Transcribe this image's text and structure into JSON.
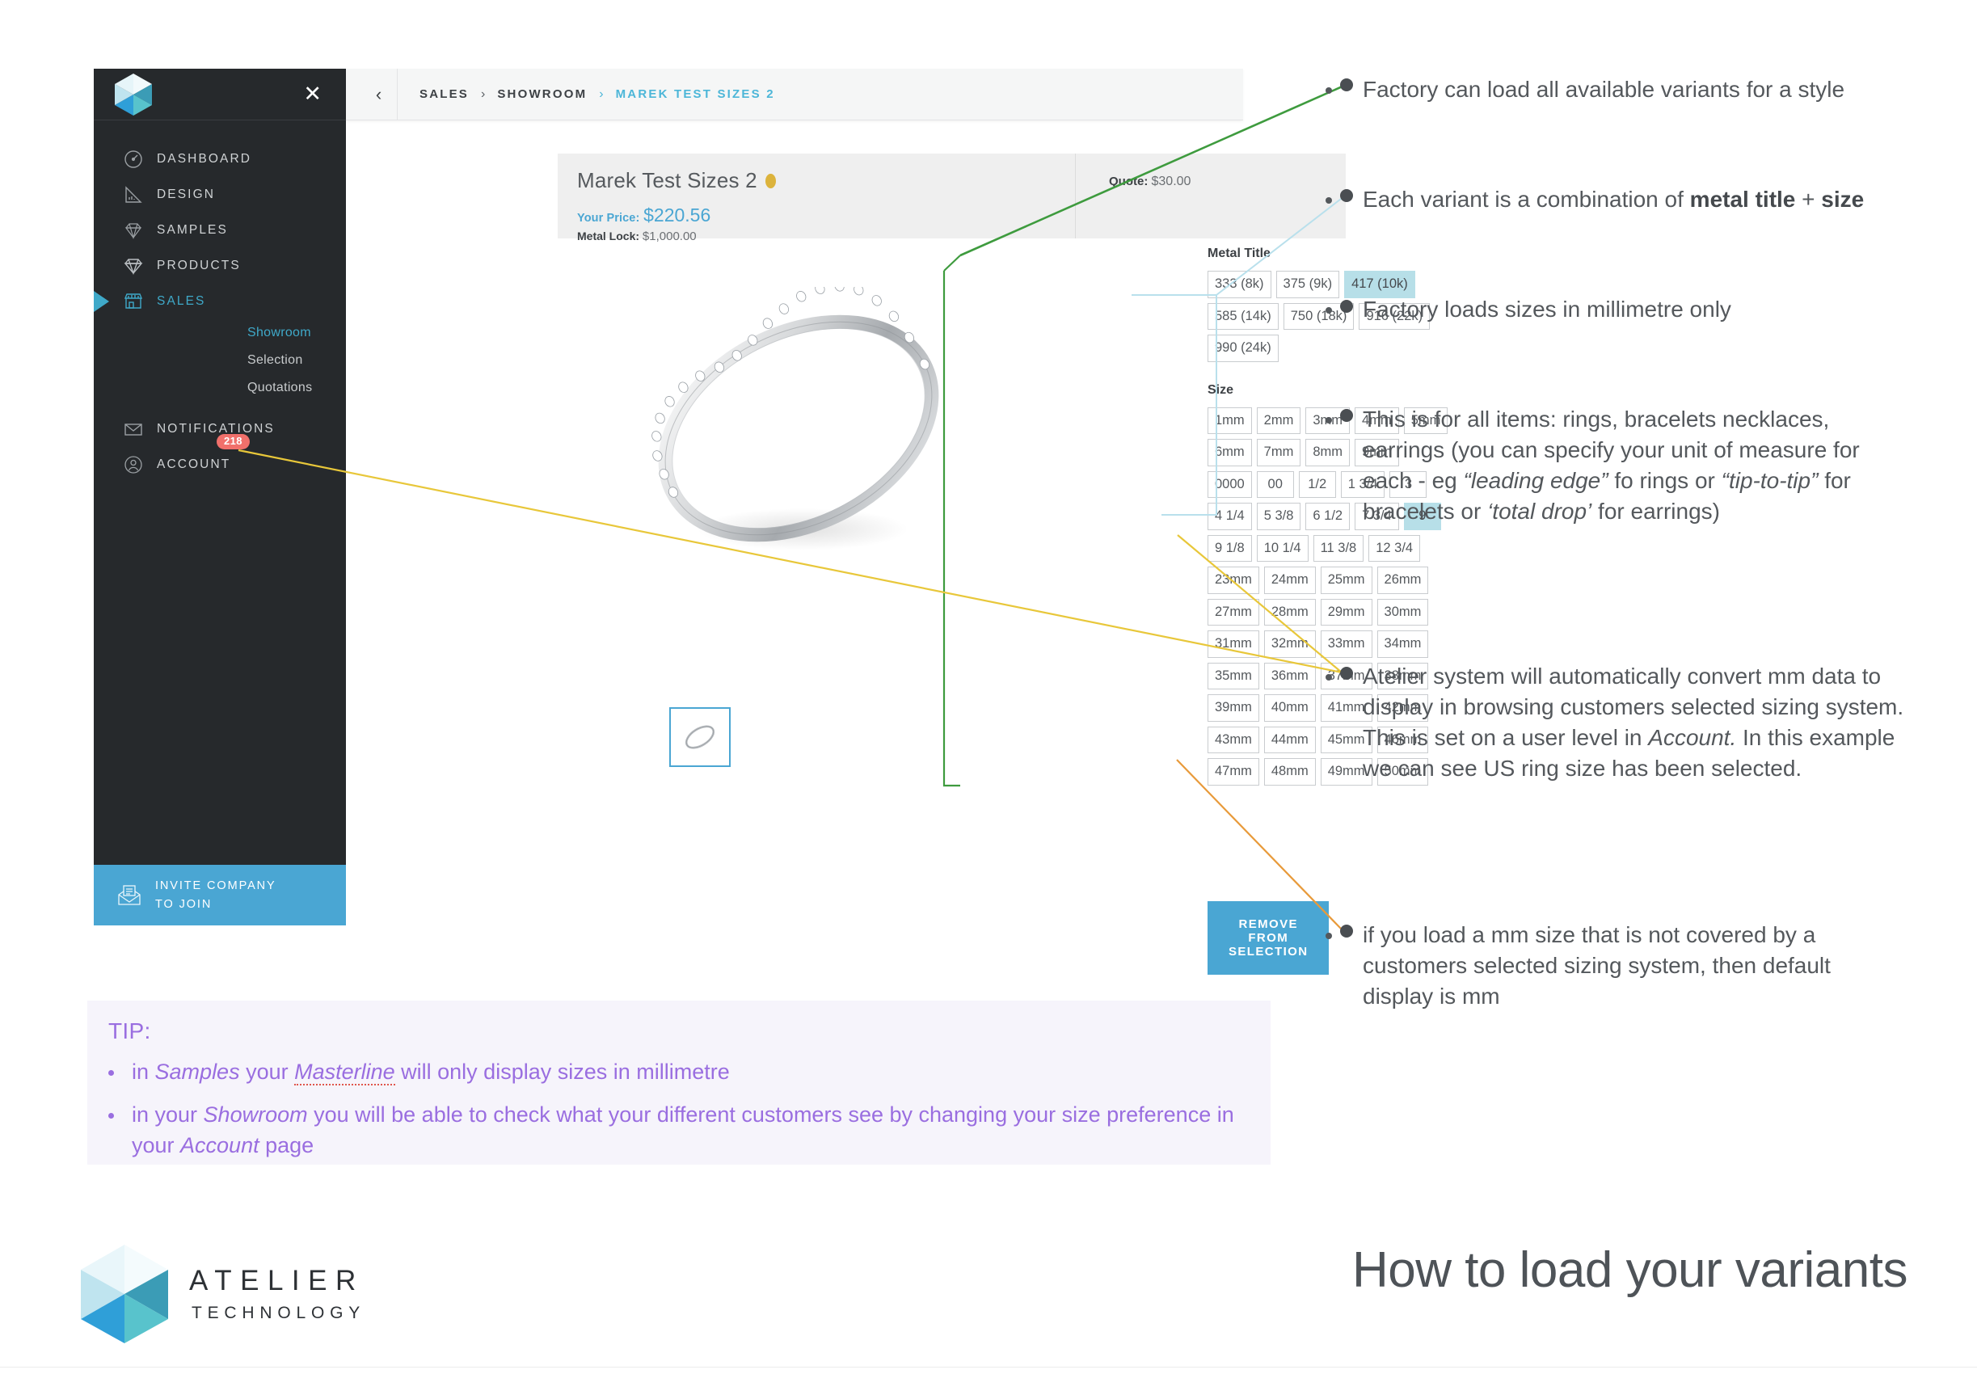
{
  "app": {
    "sidebar": {
      "logo_icon": "atelier-hexagon-logo",
      "close_icon": "close-icon",
      "items": [
        {
          "label": "DASHBOARD",
          "icon": "gauge-icon",
          "active": false
        },
        {
          "label": "DESIGN",
          "icon": "ruler-triangle-icon",
          "active": false
        },
        {
          "label": "SAMPLES",
          "icon": "gem-outline-icon",
          "active": false
        },
        {
          "label": "PRODUCTS",
          "icon": "gem-filled-icon",
          "active": false
        },
        {
          "label": "SALES",
          "icon": "storefront-icon",
          "active": true
        },
        {
          "label": "NOTIFICATIONS",
          "icon": "envelope-icon",
          "active": false
        },
        {
          "label": "ACCOUNT",
          "icon": "user-circle-icon",
          "active": false
        }
      ],
      "sub_items": [
        {
          "label": "Showroom",
          "active": true
        },
        {
          "label": "Selection",
          "active": false
        },
        {
          "label": "Quotations",
          "active": false
        }
      ],
      "notification_count": "218",
      "invite": {
        "line1": "INVITE COMPANY",
        "line2": "TO JOIN",
        "icon": "open-envelope-icon"
      }
    },
    "breadcrumb": {
      "back_icon": "chevron-left-icon",
      "separator": "›",
      "crumbs": [
        {
          "label": "SALES",
          "current": false
        },
        {
          "label": "SHOWROOM",
          "current": false
        },
        {
          "label": "MAREK TEST SIZES 2",
          "current": true
        }
      ]
    },
    "product": {
      "title": "Marek Test Sizes 2",
      "status_dot": "amber-status-dot",
      "your_price_label": "Your Price:",
      "your_price_value": "$220.56",
      "metal_lock_label": "Metal Lock:",
      "metal_lock_value": "$1,000.00",
      "quote_label": "Quote:",
      "quote_value": "$30.00",
      "image_alt": "diamond-eternity-ring",
      "thumbnail_alt": "ring-thumbnail"
    },
    "variants": {
      "metal_title_heading": "Metal Title",
      "metal_titles": [
        [
          "333 (8k)",
          "375 (9k)",
          "417 (10k)"
        ],
        [
          "585 (14k)",
          "750 (18k)",
          "916 (22k)"
        ],
        [
          "990 (24k)"
        ]
      ],
      "metal_selected": "417 (10k)",
      "size_heading": "Size",
      "sizes": [
        [
          "1mm",
          "2mm",
          "3mm",
          "4mm",
          "5mm"
        ],
        [
          "6mm",
          "7mm",
          "8mm",
          "9mm"
        ],
        [
          "0000",
          "00",
          "1/2",
          "1 3/4",
          "3"
        ],
        [
          "4 1/4",
          "5 3/8",
          "6 1/2",
          "7 3/4",
          "9"
        ],
        [
          "9 1/8",
          "10 1/4",
          "11 3/8",
          "12 3/4"
        ],
        [
          "23mm",
          "24mm",
          "25mm",
          "26mm"
        ],
        [
          "27mm",
          "28mm",
          "29mm",
          "30mm"
        ],
        [
          "31mm",
          "32mm",
          "33mm",
          "34mm"
        ],
        [
          "35mm",
          "36mm",
          "37mm",
          "38mm"
        ],
        [
          "39mm",
          "40mm",
          "41mm",
          "42mm"
        ],
        [
          "43mm",
          "44mm",
          "45mm",
          "46mm"
        ],
        [
          "47mm",
          "48mm",
          "49mm",
          "50mm"
        ]
      ],
      "size_selected": "9"
    },
    "remove_button": "REMOVE FROM SELECTION"
  },
  "annotations": [
    {
      "text": "Factory can load all available variants for a style",
      "connector_color": "#3e9b3e"
    },
    {
      "text": "Each variant is a combination of metal title + size",
      "connector_color": "#b9e0ec"
    },
    {
      "text": "Factory loads sizes in millimetre only",
      "connector_color": ""
    },
    {
      "text": "This is for all items: rings, bracelets necklaces, earrings (you can specify your unit of measure for each - eg “leading edge” fo rings or “tip-to-tip” for bracelets or ‘total drop’ for earrings)",
      "connector_color": ""
    },
    {
      "text": "Atelier system will automatically convert mm data to display in browsing customers selected sizing system. This is set on a user level in Account. In this example we can see US ring size has been selected.",
      "connector_color": "#e8c73a"
    },
    {
      "text": "if you load a mm size that is not covered by a customers selected sizing system, then default display is mm",
      "connector_color": "#e89a3a"
    }
  ],
  "tip": {
    "label": "TIP:",
    "bullets": [
      "in Samples your Masterline will only display sizes in millimetre",
      "in your Showroom you will be able to check what your different customers see by changing your size preference in your Account page"
    ]
  },
  "footer": {
    "brand_line1": "ATELIER",
    "brand_line2": "TECHNOLOGY",
    "deck_title": "How to load your variants",
    "logo_icon": "atelier-hexagon-logo"
  },
  "colors": {
    "accent_blue": "#4aa6d3",
    "sidebar_dark": "#26292c",
    "chip_selected": "#b7dfe8",
    "badge_red": "#f1706b",
    "tip_purple": "#9a6ee0",
    "gold_dot": "#dcb33c"
  }
}
